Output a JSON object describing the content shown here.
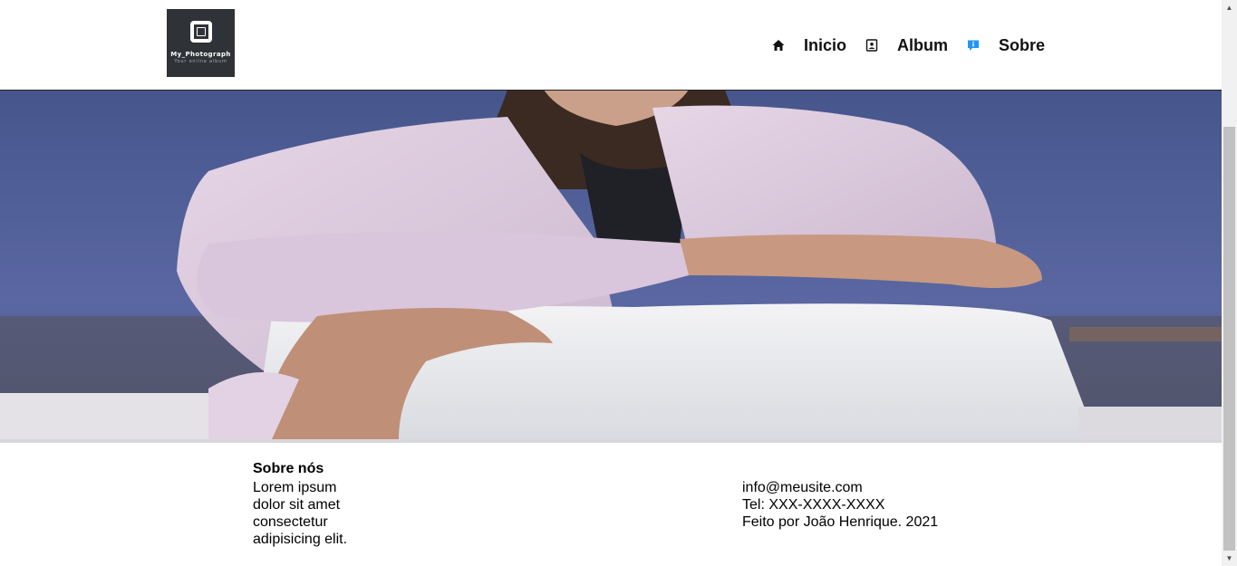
{
  "header": {
    "logo": {
      "name": "My_Photograph",
      "tagline": "Your online album"
    },
    "nav": [
      {
        "label": "Inicio",
        "icon": "home-icon"
      },
      {
        "label": "Album",
        "icon": "album-icon"
      },
      {
        "label": "Sobre",
        "icon": "info-icon"
      }
    ]
  },
  "hero": {
    "image": "photo-woman-pink-shirt"
  },
  "footer": {
    "about_title": "Sobre nós",
    "about_text": "Lorem ipsum dolor sit amet consectetur adipisicing elit.",
    "contact": {
      "email": "info@meusite.com",
      "phone": "Tel: XXX-XXXX-XXXX",
      "credit": "Feito por João Henrique. 2021"
    }
  },
  "colors": {
    "logo_bg": "#2f3237",
    "info_icon": "#2196f3",
    "text": "#000000"
  }
}
